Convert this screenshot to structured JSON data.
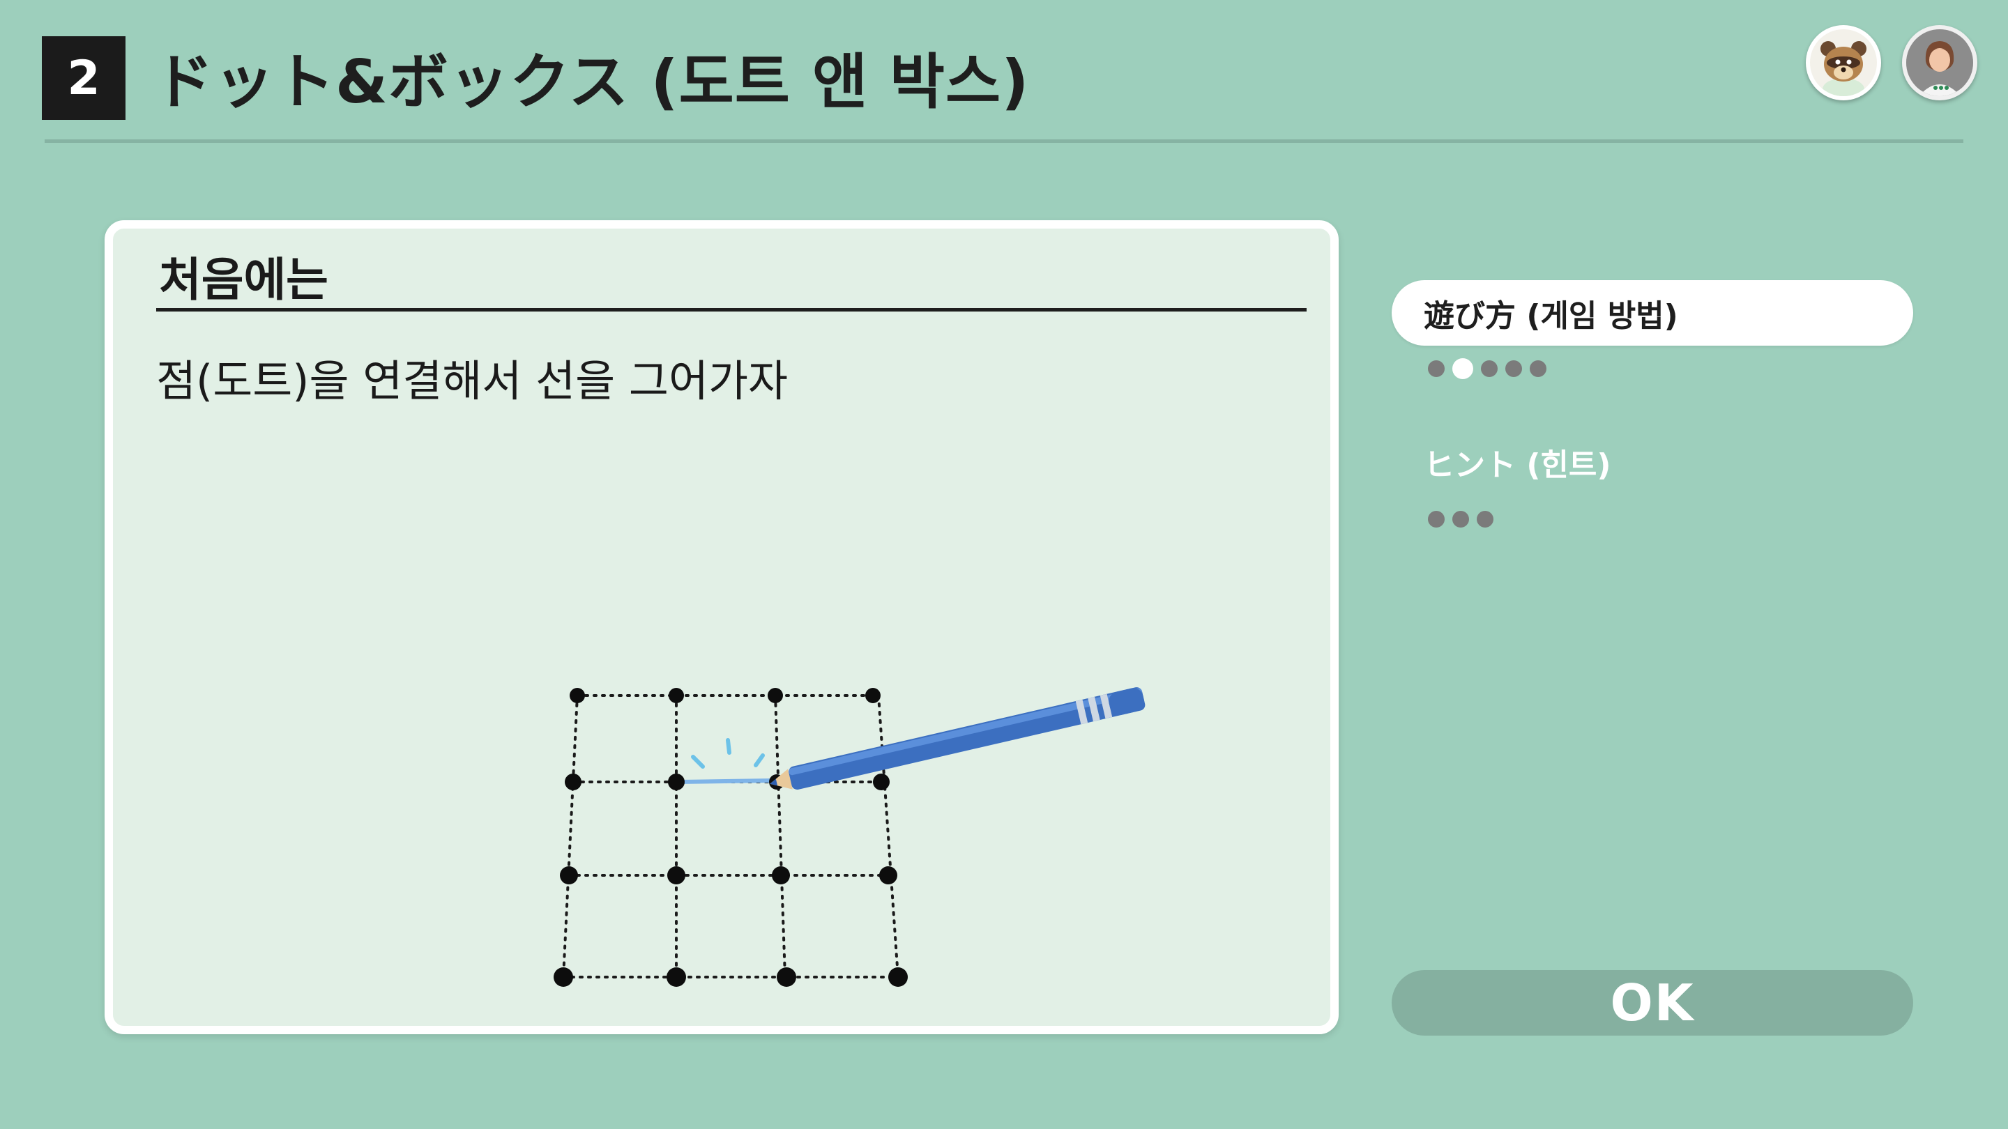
{
  "header": {
    "game_number": "2",
    "title": "ドット&ボックス (도트 앤 박스)"
  },
  "avatars": [
    {
      "name": "tom-nook-avatar"
    },
    {
      "name": "player-avatar"
    }
  ],
  "panel": {
    "heading": "처음에는",
    "instruction": "점(도트)을 연결해서 선을 그어가자"
  },
  "menu": {
    "items": [
      {
        "label": "遊び方 (게임 방법)",
        "selected": true,
        "page_count": 5,
        "current_page": 2
      },
      {
        "label": "ヒント (힌트)",
        "selected": false,
        "page_count": 3
      }
    ]
  },
  "ok_button": {
    "label": "OK"
  },
  "colors": {
    "background": "#9dcfbc",
    "panel": "#e2f0e6",
    "pencil": "#3c6fc0",
    "drawn_line": "#7fb4e8",
    "ok_button": "#85b0a0"
  },
  "icons": {
    "pencil": "pencil-icon",
    "sparkle": "sparkle-icon"
  }
}
